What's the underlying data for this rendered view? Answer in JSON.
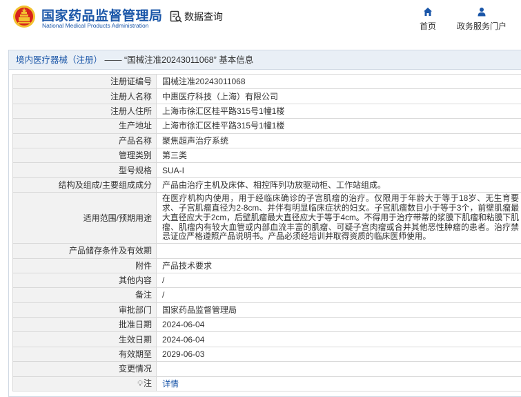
{
  "header": {
    "brand_cn": "国家药品监督管理局",
    "brand_en": "National Medical Products Administration",
    "query_label": "数据查询",
    "nav": {
      "home": "首页",
      "gov": "政务服务门户"
    },
    "colors": {
      "brand": "#1a56a8",
      "logo_red": "#d7221c",
      "logo_gold": "#f2c230"
    }
  },
  "panel": {
    "breadcrumb": "境内医疗器械（注册）",
    "title_rest": " —— “国械注准20243011068” 基本信息"
  },
  "rows": [
    {
      "label": "注册证编号",
      "value": "国械注准20243011068"
    },
    {
      "label": "注册人名称",
      "value": "中惠医疗科技（上海）有限公司"
    },
    {
      "label": "注册人住所",
      "value": "上海市徐汇区桂平路315号1幢1楼"
    },
    {
      "label": "生产地址",
      "value": "上海市徐汇区桂平路315号1幢1楼"
    },
    {
      "label": "产品名称",
      "value": "聚焦超声治疗系统"
    },
    {
      "label": "管理类别",
      "value": "第三类"
    },
    {
      "label": "型号规格",
      "value": "SUA-I"
    },
    {
      "label": "结构及组成/主要组成成分",
      "value": "产品由治疗主机及床体、相控阵列功放驱动柜、工作站组成。"
    },
    {
      "label": "适用范围/预期用途",
      "value": "在医疗机构内使用，用于经临床确诊的子宫肌瘤的治疗。仅限用于年龄大于等于18岁、无生育要求、子宫肌瘤直径为2-8cm、并伴有明显临床症状的妇女。子宫肌瘤数目小于等于3个，前壁肌瘤最大直径应大于2cm，后壁肌瘤最大直径应大于等于4cm。不得用于治疗带蒂的浆膜下肌瘤和粘膜下肌瘤、肌瘤内有较大血管或内部血流丰富的肌瘤、可疑子宫肉瘤或合并其他恶性肿瘤的患者。治疗禁忌证应严格遵照产品说明书。产品必须经培训并取得资质的临床医师使用。"
    },
    {
      "label": "产品储存条件及有效期",
      "value": ""
    },
    {
      "label": "附件",
      "value": "产品技术要求"
    },
    {
      "label": "其他内容",
      "value": "/"
    },
    {
      "label": "备注",
      "value": "/"
    },
    {
      "label": "审批部门",
      "value": "国家药品监督管理局"
    },
    {
      "label": "批准日期",
      "value": "2024-06-04"
    },
    {
      "label": "生效日期",
      "value": "2024-06-04"
    },
    {
      "label": "有效期至",
      "value": "2029-06-03"
    },
    {
      "label": "变更情况",
      "value": ""
    }
  ],
  "note_row": {
    "label": "注",
    "link": "详情",
    "icon": "lightbulb-icon"
  }
}
